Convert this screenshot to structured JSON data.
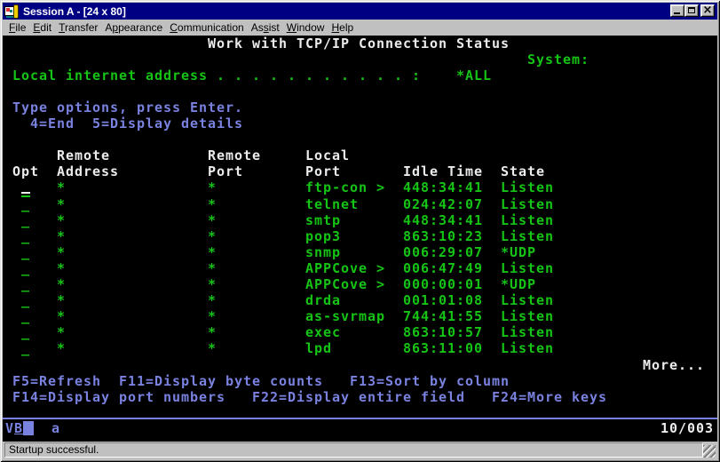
{
  "window": {
    "title": "Session A - [24 x 80]",
    "icon": "pcomm-session-icon"
  },
  "menu_bar": {
    "items": [
      {
        "label": "File",
        "underline": 0
      },
      {
        "label": "Edit",
        "underline": 0
      },
      {
        "label": "Transfer",
        "underline": 0
      },
      {
        "label": "Appearance",
        "underline": 1
      },
      {
        "label": "Communication",
        "underline": 0
      },
      {
        "label": "Assist",
        "underline": 2
      },
      {
        "label": "Window",
        "underline": 0
      },
      {
        "label": "Help",
        "underline": 0
      }
    ]
  },
  "screen": {
    "title": "Work with TCP/IP Connection Status",
    "system_label": "System:",
    "system_value": "",
    "local_address_label": "Local internet address",
    "local_address_value": "*ALL",
    "instructions": "Type options, press Enter.",
    "options": "4=End  5=Display details",
    "more_indicator": "More...",
    "function_keys": [
      "F5=Refresh",
      "F11=Display byte counts",
      "F13=Sort by column",
      "F14=Display port numbers",
      "F22=Display entire field",
      "F24=More keys"
    ],
    "display_lines": {
      "title_line": "                       Work with TCP/IP Connection Status",
      "system_line": "                                                           System:",
      "local_line": " Local internet address . . . . . . . . . . . :    *ALL",
      "prompt_line": " Type options, press Enter.",
      "options_line": "   4=End  5=Display details",
      "header1": "      Remote           Remote     Local",
      "header2": " Opt  Address          Port       Port       Idle Time  State",
      "more_line": "                                                                        More...",
      "fkeys1": " F5=Refresh  F11=Display byte counts   F13=Sort by column",
      "fkeys2": " F14=Display port numbers   F22=Display entire field   F24=More keys"
    },
    "table": {
      "columns": [
        "Opt",
        "Remote Address",
        "Remote Port",
        "Local Port",
        "Idle Time",
        "State"
      ],
      "rows": [
        {
          "opt": "_",
          "remote_address": "*",
          "remote_port": "*",
          "local_port": "ftp-con >",
          "idle_time": "448:34:41",
          "state": "Listen"
        },
        {
          "opt": "_",
          "remote_address": "*",
          "remote_port": "*",
          "local_port": "telnet",
          "idle_time": "024:42:07",
          "state": "Listen"
        },
        {
          "opt": "_",
          "remote_address": "*",
          "remote_port": "*",
          "local_port": "smtp",
          "idle_time": "448:34:41",
          "state": "Listen"
        },
        {
          "opt": "_",
          "remote_address": "*",
          "remote_port": "*",
          "local_port": "pop3",
          "idle_time": "863:10:23",
          "state": "Listen"
        },
        {
          "opt": "_",
          "remote_address": "*",
          "remote_port": "*",
          "local_port": "snmp",
          "idle_time": "006:29:07",
          "state": "*UDP"
        },
        {
          "opt": "_",
          "remote_address": "*",
          "remote_port": "*",
          "local_port": "APPCove >",
          "idle_time": "006:47:49",
          "state": "Listen"
        },
        {
          "opt": "_",
          "remote_address": "*",
          "remote_port": "*",
          "local_port": "APPCove >",
          "idle_time": "000:00:01",
          "state": "*UDP"
        },
        {
          "opt": "_",
          "remote_address": "*",
          "remote_port": "*",
          "local_port": "drda",
          "idle_time": "001:01:08",
          "state": "Listen"
        },
        {
          "opt": "_",
          "remote_address": "*",
          "remote_port": "*",
          "local_port": "as-svrmap",
          "idle_time": "744:41:55",
          "state": "Listen"
        },
        {
          "opt": "_",
          "remote_address": "*",
          "remote_port": "*",
          "local_port": "exec",
          "idle_time": "863:10:57",
          "state": "Listen"
        },
        {
          "opt": "_",
          "remote_address": "*",
          "remote_port": "*",
          "local_port": "lpd",
          "idle_time": "863:11:00",
          "state": "Listen"
        }
      ]
    }
  },
  "oia": {
    "keyboard_indicator": "VB",
    "shift_mode": "a",
    "cursor_position": "10/003"
  },
  "status_bar": {
    "message": "Startup successful."
  },
  "colors": {
    "terminal_green": "#15c415",
    "terminal_blue": "#7a82e0",
    "terminal_white": "#ececec",
    "titlebar_navy": "#000082",
    "chrome_silver": "#c0c0c0",
    "screen_black": "#000000"
  }
}
